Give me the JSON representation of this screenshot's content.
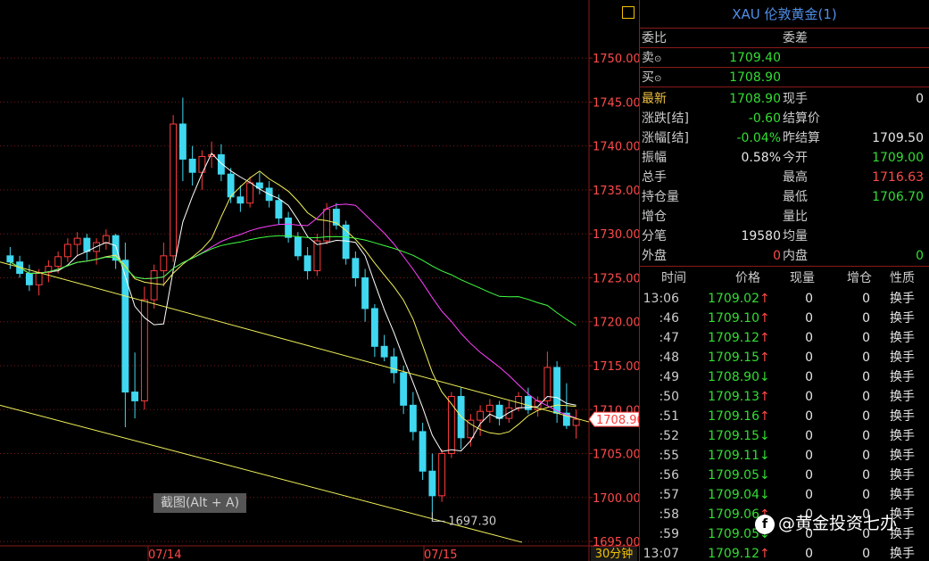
{
  "panel": {
    "title": "XAU 伦敦黄金(1)",
    "order_ratio_label": "委比",
    "order_diff_label": "委差",
    "sell_label": "卖",
    "sell_price": "1709.40",
    "buy_label": "买",
    "buy_price": "1708.90",
    "quote": [
      {
        "l1": "最新",
        "v1": "1708.90",
        "c1": "green",
        "l2": "现手",
        "v2": "0",
        "c2": "white",
        "l1c": "orange"
      },
      {
        "l1": "涨跌[结]",
        "v1": "-0.60",
        "c1": "green",
        "l2": "结算价",
        "v2": "",
        "c2": "white"
      },
      {
        "l1": "涨幅[结]",
        "v1": "-0.04%",
        "c1": "green",
        "l2": "昨结算",
        "v2": "1709.50",
        "c2": "white"
      },
      {
        "l1": "振幅",
        "v1": "0.58%",
        "c1": "white",
        "l2": "今开",
        "v2": "1709.00",
        "c2": "green"
      },
      {
        "l1": "总手",
        "v1": "",
        "c1": "white",
        "l2": "最高",
        "v2": "1716.63",
        "c2": "red"
      },
      {
        "l1": "持仓量",
        "v1": "",
        "c1": "white",
        "l2": "最低",
        "v2": "1706.70",
        "c2": "green"
      },
      {
        "l1": "增仓",
        "v1": "",
        "c1": "white",
        "l2": "量比",
        "v2": "",
        "c2": "white"
      },
      {
        "l1": "分笔",
        "v1": "19580",
        "c1": "white",
        "l2": "均量",
        "v2": "",
        "c2": "white"
      },
      {
        "l1": "外盘",
        "v1": "0",
        "c1": "red",
        "l2": "内盘",
        "v2": "0",
        "c2": "green"
      }
    ],
    "trade_headers": [
      "时间",
      "价格",
      "现量",
      "增仓",
      "性质"
    ],
    "trades": [
      {
        "time": "13:06",
        "price": "1709.02",
        "dir": "↑",
        "qty": "0",
        "oi": "0",
        "kind": "换手"
      },
      {
        "time": ":46",
        "price": "1709.10",
        "dir": "↑",
        "qty": "0",
        "oi": "0",
        "kind": "换手"
      },
      {
        "time": ":47",
        "price": "1709.12",
        "dir": "↑",
        "qty": "0",
        "oi": "0",
        "kind": "换手"
      },
      {
        "time": ":48",
        "price": "1709.15",
        "dir": "↑",
        "qty": "0",
        "oi": "0",
        "kind": "换手"
      },
      {
        "time": ":49",
        "price": "1708.90",
        "dir": "↓",
        "qty": "0",
        "oi": "0",
        "kind": "换手"
      },
      {
        "time": ":50",
        "price": "1709.13",
        "dir": "↑",
        "qty": "0",
        "oi": "0",
        "kind": "换手"
      },
      {
        "time": ":51",
        "price": "1709.16",
        "dir": "↑",
        "qty": "0",
        "oi": "0",
        "kind": "换手"
      },
      {
        "time": ":52",
        "price": "1709.15",
        "dir": "↓",
        "qty": "0",
        "oi": "0",
        "kind": "换手"
      },
      {
        "time": ":55",
        "price": "1709.11",
        "dir": "↓",
        "qty": "0",
        "oi": "0",
        "kind": "换手"
      },
      {
        "time": ":56",
        "price": "1709.05",
        "dir": "↓",
        "qty": "0",
        "oi": "0",
        "kind": "换手"
      },
      {
        "time": ":57",
        "price": "1709.04",
        "dir": "↓",
        "qty": "0",
        "oi": "0",
        "kind": "换手"
      },
      {
        "time": ":58",
        "price": "1709.06",
        "dir": "↑",
        "qty": "0",
        "oi": "0",
        "kind": "换手"
      },
      {
        "time": ":59",
        "price": "1709.05",
        "dir": "↓",
        "qty": "0",
        "oi": "0",
        "kind": "换手"
      },
      {
        "time": "13:07",
        "price": "1709.12",
        "dir": "↑",
        "qty": "0",
        "oi": "0",
        "kind": "换手"
      }
    ]
  },
  "chart": {
    "screenshot_tip": "截图(Alt + A)",
    "period_label": "30分钟",
    "low_marker": "1697.30",
    "current_price": "1708.90",
    "date_labels": [
      "07/14",
      "07/15"
    ],
    "colors": {
      "up": "#ff3c3c",
      "down": "#3fd8f0",
      "ma5": "#ffffff",
      "ma10": "#f2f25a",
      "ma20": "#ff40ff",
      "ma40": "#40ff40",
      "trend": "#f2f25a",
      "grid": "#7a1a1a"
    }
  },
  "watermark": "@黄金投资七办",
  "chart_data": {
    "type": "candlestick",
    "ylim": [
      1694.5,
      1756.0
    ],
    "y_ticks": [
      1695.0,
      1700.0,
      1705.0,
      1710.0,
      1715.0,
      1720.0,
      1725.0,
      1730.0,
      1735.0,
      1740.0,
      1745.0,
      1750.0
    ],
    "y_tick_labels": [
      "1695.00",
      "1700.00",
      "1705.00",
      "1710.00",
      "1715.00",
      "1720.00",
      "1725.00",
      "1730.00",
      "1735.00",
      "1740.00",
      "1745.00",
      "1750.00"
    ],
    "x_labels": [
      "07/14",
      "07/15"
    ],
    "candles": [
      [
        1727.5,
        1728.5,
        1726.0,
        1726.8
      ],
      [
        1726.8,
        1727.5,
        1725.0,
        1725.5
      ],
      [
        1725.5,
        1726.5,
        1723.5,
        1724.2
      ],
      [
        1724.2,
        1726.0,
        1723.0,
        1725.6
      ],
      [
        1725.6,
        1727.0,
        1724.5,
        1726.3
      ],
      [
        1726.3,
        1728.0,
        1725.5,
        1727.4
      ],
      [
        1727.4,
        1729.5,
        1726.8,
        1728.8
      ],
      [
        1728.8,
        1730.2,
        1727.5,
        1729.5
      ],
      [
        1729.5,
        1730.0,
        1727.0,
        1728.0
      ],
      [
        1728.0,
        1729.5,
        1726.5,
        1729.0
      ],
      [
        1729.0,
        1730.5,
        1728.2,
        1729.8
      ],
      [
        1729.8,
        1730.0,
        1726.0,
        1727.0
      ],
      [
        1727.0,
        1729.0,
        1708.0,
        1712.0
      ],
      [
        1712.0,
        1716.5,
        1709.0,
        1711.0
      ],
      [
        1711.0,
        1724.0,
        1710.0,
        1722.5
      ],
      [
        1722.5,
        1726.5,
        1721.5,
        1725.8
      ],
      [
        1725.8,
        1729.0,
        1724.0,
        1727.5
      ],
      [
        1727.5,
        1743.5,
        1726.8,
        1742.5
      ],
      [
        1742.5,
        1745.5,
        1736.0,
        1738.5
      ],
      [
        1738.5,
        1740.0,
        1735.5,
        1737.0
      ],
      [
        1737.0,
        1739.5,
        1735.0,
        1738.8
      ],
      [
        1738.8,
        1740.5,
        1737.5,
        1739.0
      ],
      [
        1739.0,
        1740.2,
        1736.0,
        1736.8
      ],
      [
        1736.8,
        1737.5,
        1733.5,
        1734.2
      ],
      [
        1734.2,
        1735.5,
        1732.5,
        1733.5
      ],
      [
        1733.5,
        1736.5,
        1733.0,
        1735.8
      ],
      [
        1735.8,
        1737.0,
        1734.5,
        1735.2
      ],
      [
        1735.2,
        1736.0,
        1733.0,
        1733.8
      ],
      [
        1733.8,
        1734.5,
        1731.0,
        1731.8
      ],
      [
        1731.8,
        1732.5,
        1729.0,
        1729.6
      ],
      [
        1729.6,
        1730.2,
        1727.0,
        1727.5
      ],
      [
        1727.5,
        1728.5,
        1724.8,
        1725.8
      ],
      [
        1725.8,
        1730.0,
        1725.2,
        1729.2
      ],
      [
        1729.2,
        1733.5,
        1728.8,
        1732.8
      ],
      [
        1732.8,
        1733.5,
        1730.5,
        1731.0
      ],
      [
        1731.0,
        1731.5,
        1726.5,
        1727.2
      ],
      [
        1727.2,
        1728.0,
        1724.0,
        1725.0
      ],
      [
        1725.0,
        1726.0,
        1720.0,
        1721.5
      ],
      [
        1721.5,
        1722.0,
        1716.0,
        1717.2
      ],
      [
        1717.2,
        1718.5,
        1715.5,
        1716.0
      ],
      [
        1716.0,
        1717.0,
        1713.0,
        1714.2
      ],
      [
        1714.2,
        1715.0,
        1709.5,
        1710.5
      ],
      [
        1710.5,
        1712.0,
        1706.5,
        1707.5
      ],
      [
        1707.5,
        1708.5,
        1702.0,
        1703.0
      ],
      [
        1703.0,
        1705.0,
        1697.3,
        1700.2
      ],
      [
        1700.2,
        1705.5,
        1699.5,
        1705.0
      ],
      [
        1705.0,
        1712.0,
        1704.5,
        1711.5
      ],
      [
        1711.5,
        1712.5,
        1705.5,
        1706.8
      ],
      [
        1706.8,
        1709.5,
        1705.8,
        1708.8
      ],
      [
        1708.8,
        1710.5,
        1707.0,
        1709.8
      ],
      [
        1709.8,
        1711.2,
        1708.5,
        1710.5
      ],
      [
        1710.5,
        1711.0,
        1708.2,
        1709.0
      ],
      [
        1709.0,
        1711.0,
        1708.5,
        1710.2
      ],
      [
        1710.2,
        1712.0,
        1709.8,
        1711.5
      ],
      [
        1711.5,
        1712.5,
        1709.5,
        1710.0
      ],
      [
        1710.0,
        1711.5,
        1709.2,
        1711.0
      ],
      [
        1711.0,
        1716.6,
        1710.5,
        1714.8
      ],
      [
        1714.8,
        1715.5,
        1708.5,
        1709.6
      ],
      [
        1709.6,
        1713.0,
        1707.8,
        1708.2
      ],
      [
        1708.2,
        1710.0,
        1706.7,
        1708.9
      ]
    ]
  }
}
